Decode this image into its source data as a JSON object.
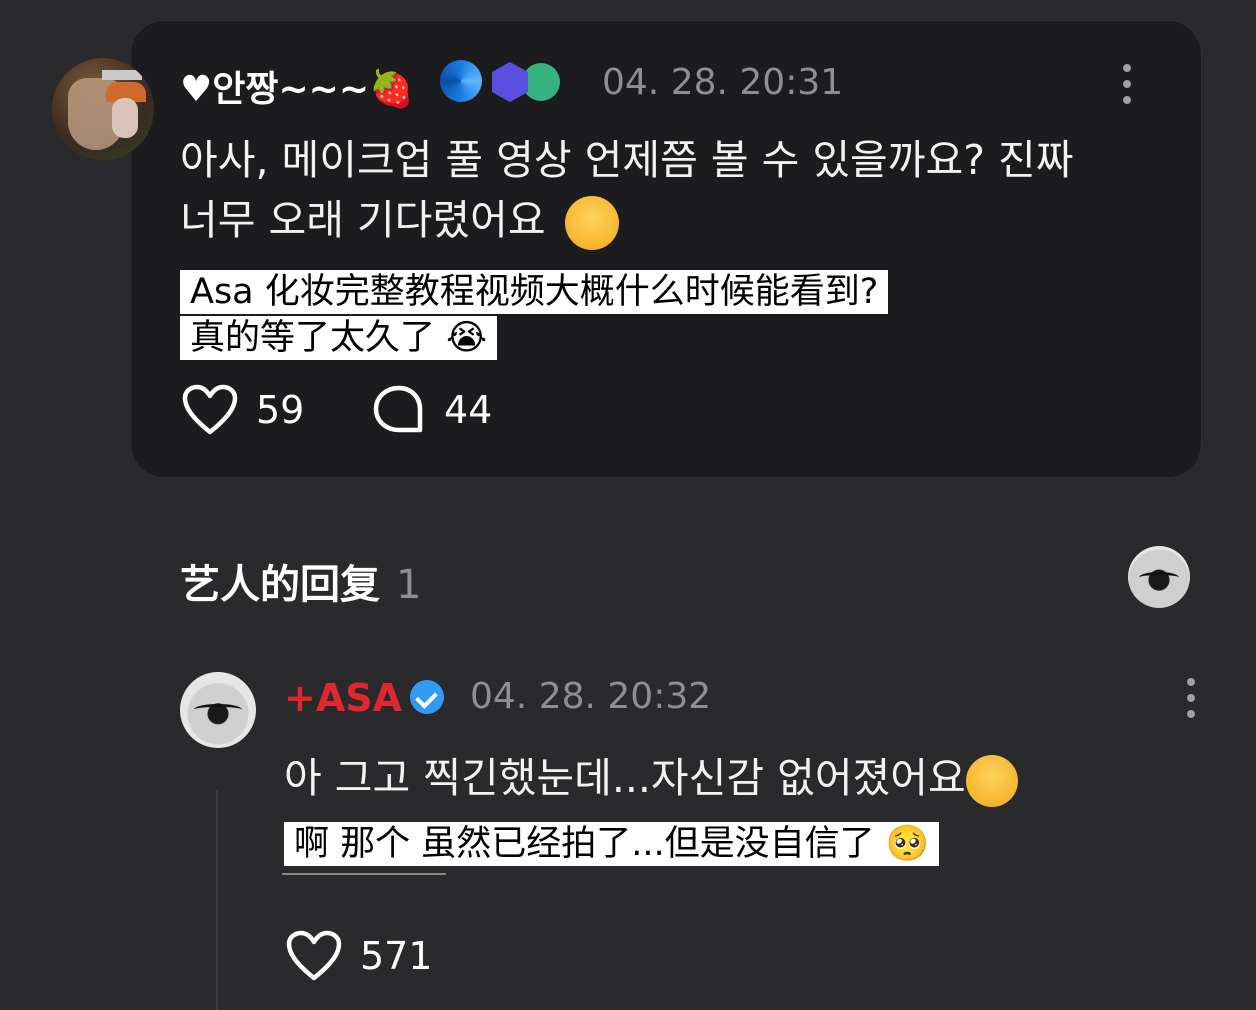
{
  "post": {
    "username": "♥안짱~~~🍓",
    "timestamp": "04. 28. 20:31",
    "text_line1": "아사, 메이크업 풀 영상 언제쯤 볼 수 있을까요? 진짜",
    "text_line2": "너무 오래 기다렸어요",
    "translation_line1": "Asa 化妆完整教程视频大概什么时候能看到?",
    "translation_line2": "真的等了太久了 😭",
    "likes": "59",
    "replies": "44"
  },
  "section": {
    "title": "艺人的回复",
    "count": "1"
  },
  "reply": {
    "username": "+ASA",
    "timestamp": "04. 28. 20:32",
    "text": "아 그고 찍긴했눈데...자신감 없어졌어요",
    "translation": "啊 那个 虽然已经拍了...但是没自信了 🥺",
    "likes": "571"
  },
  "colors": {
    "background": "#2a2a2c",
    "card": "#1c1c1e",
    "accent_red": "#e0262f",
    "muted": "#8e8e93",
    "verified_blue": "#2f9bf5"
  },
  "icons": [
    "more-vertical-icon",
    "heart-icon",
    "comment-bubble-icon",
    "verified-badge-icon",
    "spiral-badge-icon",
    "heart-shield-badge-icon"
  ]
}
